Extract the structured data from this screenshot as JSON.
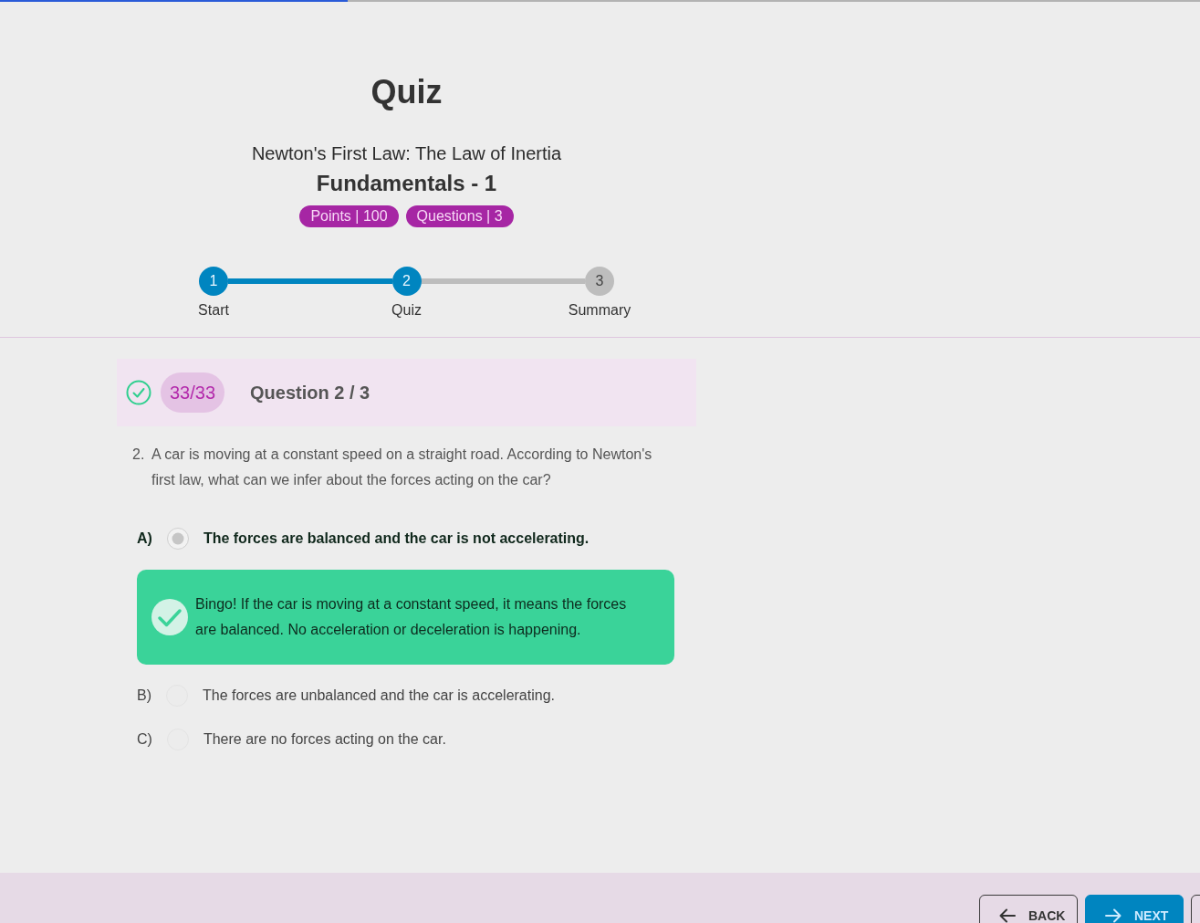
{
  "progress_bar": {
    "level": 0.29
  },
  "header": {
    "title": "Quiz",
    "subtitle": "Newton's First Law: The Law of Inertia",
    "lesson": "Fundamentals - 1",
    "badges": [
      "Points | 100",
      "Questions | 3"
    ]
  },
  "stepper": [
    {
      "number": "1",
      "label": "Start",
      "active": true
    },
    {
      "number": "2",
      "label": "Quiz",
      "active": true
    },
    {
      "number": "3",
      "label": "Summary",
      "active": false
    }
  ],
  "question_header": {
    "correct": true,
    "score": "33/33",
    "title": "Question 2 / 3"
  },
  "question": {
    "number": "2.",
    "text": "A car is moving at a constant speed on a straight road. According to Newton's first law, what can we infer about the forces acting on the car?"
  },
  "options": [
    {
      "letter": "A)",
      "text": "The forces are balanced and the car is not accelerating.",
      "selected": true,
      "feedback": {
        "kind": "correct",
        "text": "Bingo! If the car is moving at a constant speed, it means the forces are balanced. No acceleration or deceleration is happening."
      }
    },
    {
      "letter": "B)",
      "text": "The forces are unbalanced and the car is accelerating.",
      "selected": false
    },
    {
      "letter": "C)",
      "text": "There are no forces acting on the car.",
      "selected": false
    }
  ],
  "footer_buttons": [
    {
      "kind": "back",
      "label": "BACK"
    },
    {
      "kind": "next",
      "label": "NEXT"
    },
    {
      "kind": "outline"
    }
  ]
}
